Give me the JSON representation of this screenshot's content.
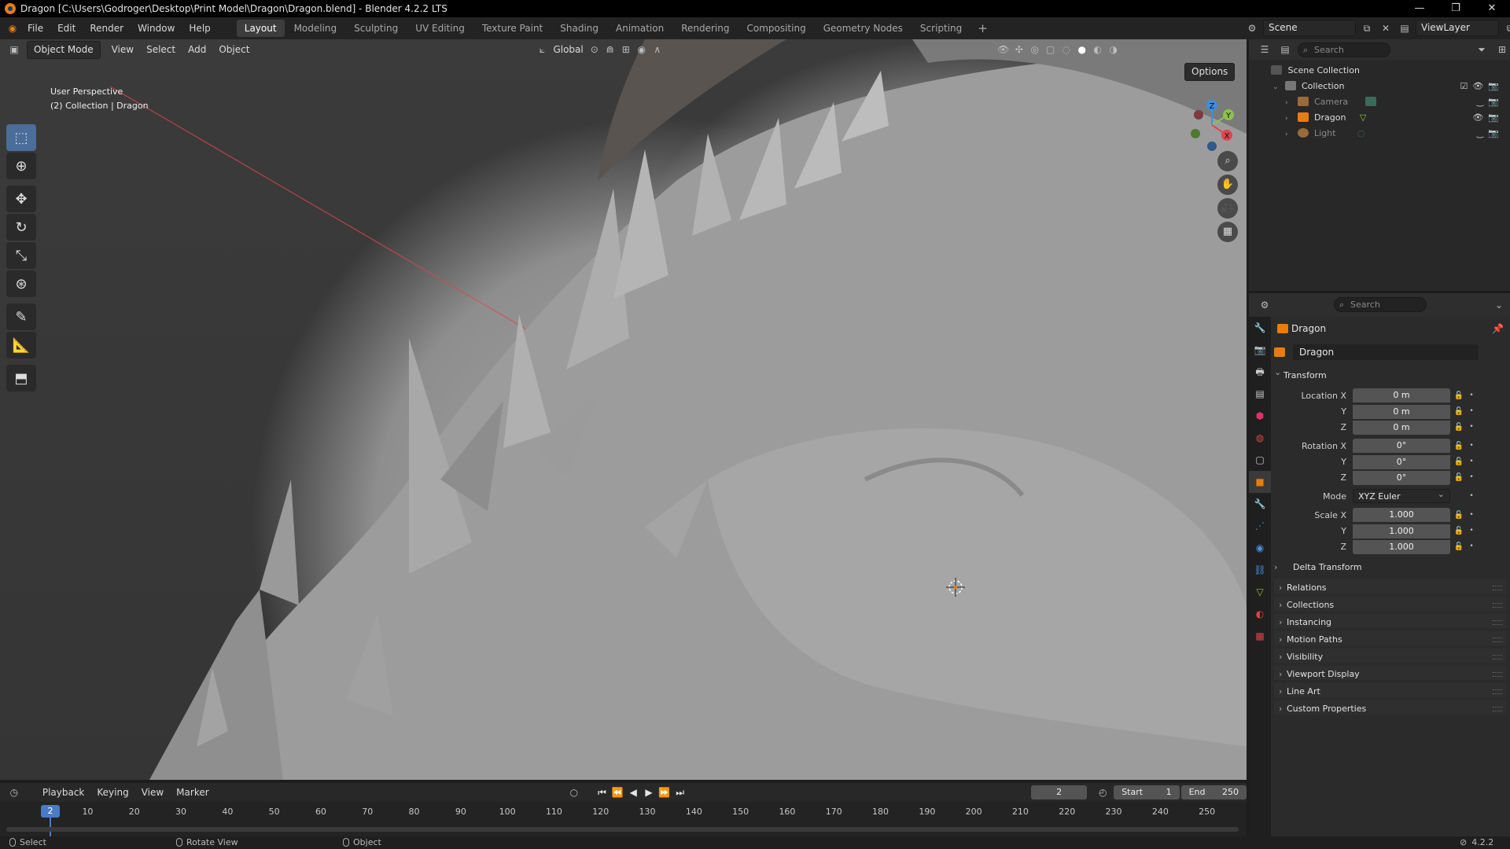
{
  "window": {
    "title": "Dragon [C:\\Users\\Godroger\\Desktop\\Print Model\\Dragon\\Dragon.blend] - Blender 4.2.2 LTS",
    "controls": [
      "—",
      "❐",
      "✕"
    ]
  },
  "menu": {
    "items": [
      "File",
      "Edit",
      "Render",
      "Window",
      "Help"
    ]
  },
  "workspaces": [
    "Layout",
    "Modeling",
    "Sculpting",
    "UV Editing",
    "Texture Paint",
    "Shading",
    "Animation",
    "Rendering",
    "Compositing",
    "Geometry Nodes",
    "Scripting"
  ],
  "workspace_active": "Layout",
  "scene": {
    "name": "Scene",
    "view_layer": "ViewLayer"
  },
  "viewport": {
    "mode": "Object Mode",
    "menus": [
      "View",
      "Select",
      "Add",
      "Object"
    ],
    "transform_orientation": "Global",
    "options_label": "Options",
    "view_name": "User Perspective",
    "view_context": "(2) Collection | Dragon",
    "gizmo_axes": {
      "x": "X",
      "y": "Y",
      "z": "Z"
    }
  },
  "outliner": {
    "search_placeholder": "Search",
    "root": "Scene Collection",
    "collection": "Collection",
    "objects": [
      {
        "name": "Camera",
        "icon": "camera-icon",
        "visible": false
      },
      {
        "name": "Dragon",
        "icon": "mesh-icon",
        "visible": true
      },
      {
        "name": "Light",
        "icon": "light-icon",
        "visible": false
      }
    ]
  },
  "properties": {
    "search_placeholder": "Search",
    "object_title": "Dragon",
    "object_name": "Dragon",
    "transform_label": "Transform",
    "location": {
      "label": "Location X",
      "x": "0 m",
      "y": "0 m",
      "z": "0 m"
    },
    "rotation": {
      "label": "Rotation X",
      "x": "0°",
      "y": "0°",
      "z": "0°"
    },
    "mode": {
      "label": "Mode",
      "value": "XYZ Euler"
    },
    "scale": {
      "label": "Scale X",
      "x": "1.000",
      "y": "1.000",
      "z": "1.000"
    },
    "axis_y": "Y",
    "axis_z": "Z",
    "delta_transform": "Delta Transform",
    "panels": [
      "Relations",
      "Collections",
      "Instancing",
      "Motion Paths",
      "Visibility",
      "Viewport Display",
      "Line Art",
      "Custom Properties"
    ]
  },
  "timeline": {
    "menus": [
      "Playback",
      "Keying",
      "View",
      "Marker"
    ],
    "current_frame": "2",
    "start_label": "Start",
    "start": "1",
    "end_label": "End",
    "end": "250",
    "ticks": [
      "10",
      "20",
      "30",
      "40",
      "50",
      "60",
      "70",
      "80",
      "90",
      "100",
      "110",
      "120",
      "130",
      "140",
      "150",
      "160",
      "170",
      "180",
      "190",
      "200",
      "210",
      "220",
      "230",
      "240",
      "250"
    ]
  },
  "statusbar": {
    "select": "Select",
    "rotate": "Rotate View",
    "object": "Object",
    "version": "4.2.2"
  },
  "colors": {
    "accent": "#4a7bc5",
    "axis_x": "#e0454e",
    "axis_y": "#8bc34a",
    "axis_z": "#3d8fe0",
    "object_orange": "#e87d0d"
  }
}
